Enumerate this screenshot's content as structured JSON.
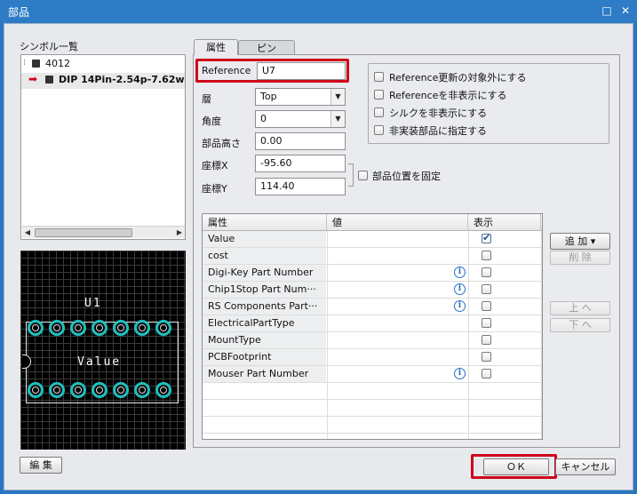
{
  "window": {
    "title": "部品"
  },
  "symbols": {
    "header": "シンボル一覧",
    "items": [
      {
        "label": "4012"
      },
      {
        "label": "DIP 14Pin-2.54p-7.62w"
      }
    ]
  },
  "preview": {
    "ref_label": "U1",
    "value_label": "Value"
  },
  "left_buttons": {
    "edit": "編 集"
  },
  "tabs": [
    {
      "label": "属性"
    },
    {
      "label": "ピン"
    }
  ],
  "form": {
    "reference_label": "Reference",
    "reference_value": "U7",
    "layer_label": "層",
    "layer_value": "Top",
    "angle_label": "角度",
    "angle_value": "0",
    "height_label": "部品高さ",
    "height_value": "0.00",
    "x_label": "座標X",
    "x_value": "-95.60",
    "y_label": "座標Y",
    "y_value": "114.40",
    "fix_position_label": "部品位置を固定"
  },
  "options": [
    {
      "label": "Reference更新の対象外にする",
      "checked": false
    },
    {
      "label": "Referenceを非表示にする",
      "checked": false
    },
    {
      "label": "シルクを非表示にする",
      "checked": false
    },
    {
      "label": "非実装部品に指定する",
      "checked": false
    }
  ],
  "attributes": {
    "columns": [
      "属性",
      "値",
      "表示"
    ],
    "rows": [
      {
        "name": "Value",
        "value": "",
        "info": false,
        "shown": true
      },
      {
        "name": "cost",
        "value": "",
        "info": false,
        "shown": false
      },
      {
        "name": "Digi-Key Part Number",
        "value": "",
        "info": true,
        "shown": false
      },
      {
        "name": "Chip1Stop Part Num···",
        "value": "",
        "info": true,
        "shown": false
      },
      {
        "name": "RS Components Part···",
        "value": "",
        "info": true,
        "shown": false
      },
      {
        "name": "ElectricalPartType",
        "value": "",
        "info": false,
        "shown": false
      },
      {
        "name": "MountType",
        "value": "",
        "info": false,
        "shown": false
      },
      {
        "name": "PCBFootprint",
        "value": "",
        "info": false,
        "shown": false
      },
      {
        "name": "Mouser Part Number",
        "value": "",
        "info": true,
        "shown": false
      }
    ]
  },
  "side_buttons": {
    "add": "追 加 ▾",
    "delete": "削 除",
    "up": "上 へ",
    "down": "下 へ"
  },
  "footer": {
    "ok": "ＯＫ",
    "cancel": "キャンセル"
  },
  "colors": {
    "accent": "#2e7cc6",
    "highlight": "#d0021b",
    "pad": "#1fbfbf",
    "silk": "#ffffff"
  }
}
